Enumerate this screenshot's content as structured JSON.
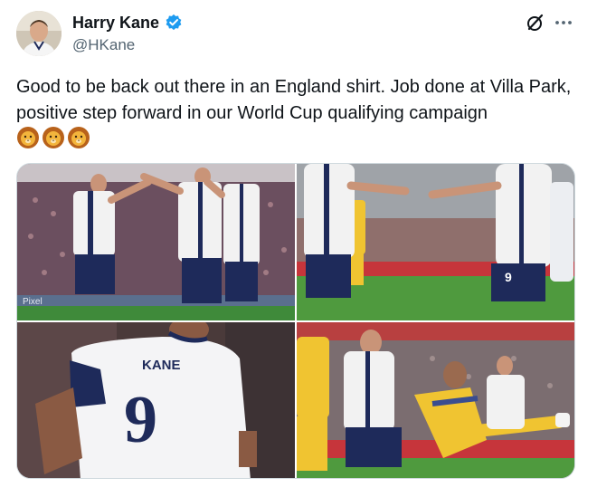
{
  "author": {
    "display_name": "Harry Kane",
    "handle": "@HKane",
    "avatar_icon": "profile-photo",
    "verified_icon": "verified-badge-icon",
    "verified_color": "#1d9bf0"
  },
  "actions": {
    "grok_icon": "grok-icon",
    "more_icon": "more-options-icon"
  },
  "tweet": {
    "text": "Good to be back out there in an England shirt. Job done at Villa Park, positive step forward in our World Cup qualifying campaign",
    "emoji": [
      "lion-face-emoji",
      "lion-face-emoji",
      "lion-face-emoji"
    ]
  },
  "media": {
    "photos": [
      {
        "id": "photo-1",
        "banner_text": "Pixel"
      },
      {
        "id": "photo-2",
        "shirt_number": "9"
      },
      {
        "id": "photo-3",
        "shirt_name": "KANE",
        "shirt_number": "9"
      },
      {
        "id": "photo-4"
      }
    ]
  },
  "colors": {
    "text_primary": "#0f1419",
    "text_secondary": "#536471",
    "border": "#cfd9de",
    "england_navy": "#1e2a5a",
    "pitch_green": "#3f8a3a"
  }
}
